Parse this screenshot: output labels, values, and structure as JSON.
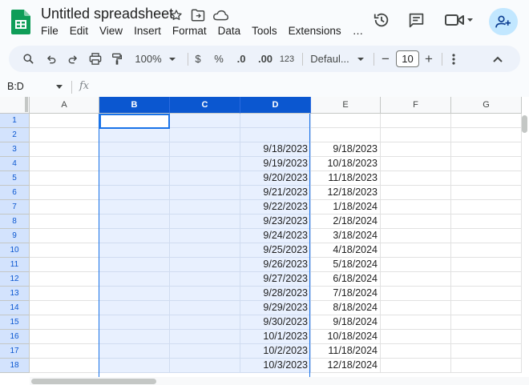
{
  "document": {
    "title": "Untitled spreadsheet"
  },
  "menu": [
    "File",
    "Edit",
    "View",
    "Insert",
    "Format",
    "Data",
    "Tools",
    "Extensions",
    "…"
  ],
  "toolbar": {
    "zoom": "100%",
    "currency_label": "$",
    "percent_label": "%",
    "decrease_decimals_label": ".0",
    "increase_decimals_label": ".00",
    "number_format_label": "123",
    "font_name": "Defaul...",
    "font_size": "10",
    "decrease_size_label": "−",
    "increase_size_label": "+"
  },
  "formula_bar": {
    "name_box": "B:D",
    "fx_label": "fx"
  },
  "grid": {
    "columns": [
      "A",
      "B",
      "C",
      "D",
      "E",
      "F",
      "G"
    ],
    "selected_columns": [
      "B",
      "C",
      "D"
    ],
    "rows": [
      {
        "n": "1",
        "D": "",
        "E": ""
      },
      {
        "n": "2",
        "D": "",
        "E": ""
      },
      {
        "n": "3",
        "D": "9/18/2023",
        "E": "9/18/2023"
      },
      {
        "n": "4",
        "D": "9/19/2023",
        "E": "10/18/2023"
      },
      {
        "n": "5",
        "D": "9/20/2023",
        "E": "11/18/2023"
      },
      {
        "n": "6",
        "D": "9/21/2023",
        "E": "12/18/2023"
      },
      {
        "n": "7",
        "D": "9/22/2023",
        "E": "1/18/2024"
      },
      {
        "n": "8",
        "D": "9/23/2023",
        "E": "2/18/2024"
      },
      {
        "n": "9",
        "D": "9/24/2023",
        "E": "3/18/2024"
      },
      {
        "n": "10",
        "D": "9/25/2023",
        "E": "4/18/2024"
      },
      {
        "n": "11",
        "D": "9/26/2023",
        "E": "5/18/2024"
      },
      {
        "n": "12",
        "D": "9/27/2023",
        "E": "6/18/2024"
      },
      {
        "n": "13",
        "D": "9/28/2023",
        "E": "7/18/2024"
      },
      {
        "n": "14",
        "D": "9/29/2023",
        "E": "8/18/2024"
      },
      {
        "n": "15",
        "D": "9/30/2023",
        "E": "9/18/2024"
      },
      {
        "n": "16",
        "D": "10/1/2023",
        "E": "10/18/2024"
      },
      {
        "n": "17",
        "D": "10/2/2023",
        "E": "11/18/2024"
      },
      {
        "n": "18",
        "D": "10/3/2023",
        "E": "12/18/2024"
      }
    ]
  },
  "colors": {
    "accent": "#0b57d0",
    "selection_fill": "#e8f0fe",
    "share_button": "#c2e7ff",
    "logo_green": "#0f9d58"
  },
  "icons": {
    "star": "star-icon",
    "move": "move-to-folder-icon",
    "cloud": "cloud-status-icon",
    "history": "version-history-icon",
    "comments": "comments-icon",
    "meet": "video-call-icon",
    "share": "share-icon"
  }
}
